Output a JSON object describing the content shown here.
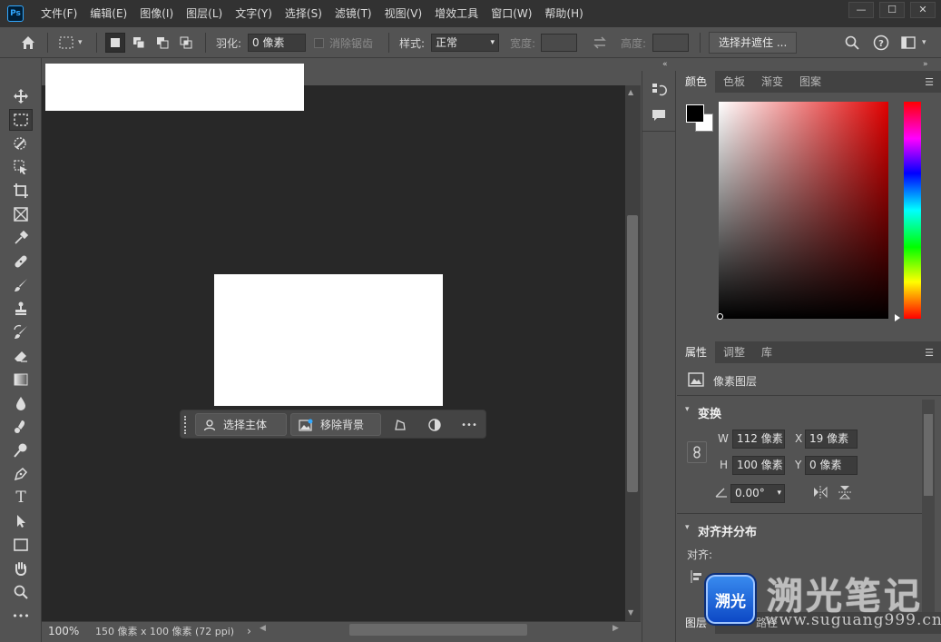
{
  "app": {
    "logo_text": "Ps"
  },
  "menu": [
    "文件(F)",
    "编辑(E)",
    "图像(I)",
    "图层(L)",
    "文字(Y)",
    "选择(S)",
    "滤镜(T)",
    "视图(V)",
    "增效工具",
    "窗口(W)",
    "帮助(H)"
  ],
  "window_controls": {
    "minimize": "—",
    "maximize": "☐",
    "close": "✕"
  },
  "options": {
    "feather_label": "羽化:",
    "feather_value": "0 像素",
    "antialias_label": "消除锯齿",
    "style_label": "样式:",
    "style_value": "正常",
    "width_label": "宽度:",
    "height_label": "高度:",
    "select_mask_label": "选择并遮住 ..."
  },
  "tools": [
    "move-tool",
    "rect-marquee-tool",
    "object-select-tool",
    "quick-select-tool",
    "crop-tool",
    "frame-tool",
    "eyedropper-tool",
    "healing-tool",
    "brush-tool",
    "stamp-tool",
    "history-brush-tool",
    "eraser-tool",
    "gradient-tool",
    "blur-tool",
    "smudge-tool",
    "dodge-tool",
    "pen-tool",
    "type-tool",
    "path-select-tool",
    "rectangle-tool",
    "hand-tool",
    "zoom-tool",
    "more-tools"
  ],
  "type_tool_glyph": "T",
  "more_tools_glyph": "•••",
  "taskbar": {
    "select_subject": "选择主体",
    "remove_background": "移除背景",
    "more": "•••"
  },
  "status": {
    "zoom": "100%",
    "doc_info": "150 像素 x 100 像素 (72 ppi)",
    "arrow": "›"
  },
  "color_panel": {
    "tabs": [
      "颜色",
      "色板",
      "渐变",
      "图案"
    ],
    "active": "颜色"
  },
  "properties_panel": {
    "tabs": [
      "属性",
      "调整",
      "库"
    ],
    "layer_type": "像素图层",
    "transform_title": "变换",
    "w_label": "W",
    "w_value": "112 像素",
    "h_label": "H",
    "h_value": "100 像素",
    "x_label": "X",
    "x_value": "19 像素",
    "y_label": "Y",
    "y_value": "0 像素",
    "angle_value": "0.00°",
    "align_title": "对齐并分布",
    "align_label": "对齐:"
  },
  "layers_tab": {
    "label": "图层",
    "paths_label": "路径"
  },
  "watermark": {
    "logo_text": "溯光",
    "title": "溯光笔记",
    "url": "www.suguang999.cn"
  },
  "colors": {
    "foreground": "#000000",
    "background": "#ffffff"
  }
}
